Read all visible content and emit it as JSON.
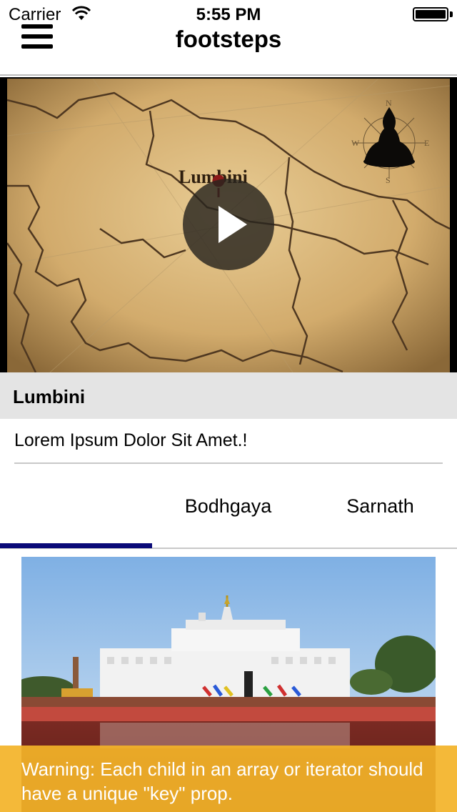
{
  "status_bar": {
    "carrier": "Carrier",
    "time": "5:55 PM"
  },
  "nav": {
    "title": "footsteps"
  },
  "video": {
    "map_label": "Lumbini",
    "compass_letters": [
      "N",
      "W",
      "E",
      "S"
    ]
  },
  "location": {
    "title": "Lumbini",
    "description": "Lorem Ipsum Dolor Sit Amet.!"
  },
  "tabs": [
    {
      "label": "",
      "selected": true
    },
    {
      "label": "Bodhgaya",
      "selected": false
    },
    {
      "label": "Sarnath",
      "selected": false
    }
  ],
  "warning": {
    "text": "Warning: Each child in an array or iterator should have a unique \"key\" prop."
  },
  "colors": {
    "tab_indicator": "#0a0a78",
    "warning_bg": "#f3b328",
    "map_parchment": "#d7b47a"
  }
}
